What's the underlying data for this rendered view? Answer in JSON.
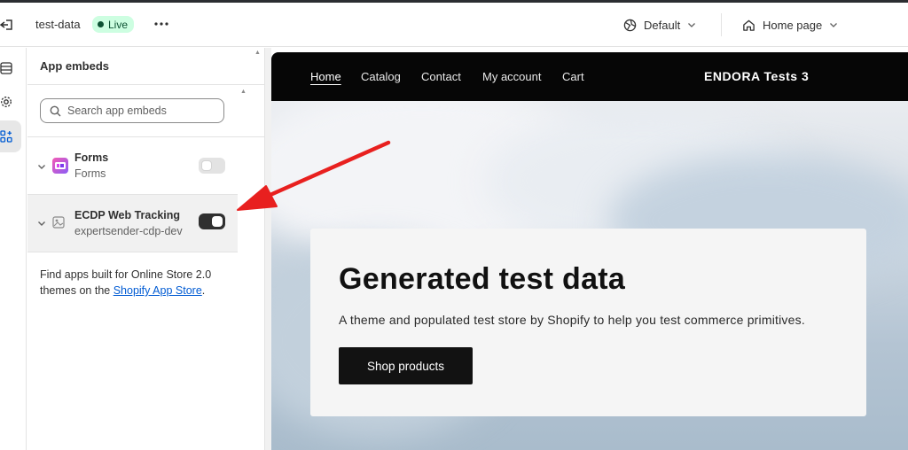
{
  "topbar": {
    "store_name": "test-data",
    "status_badge": "Live",
    "theme_select": "Default",
    "page_select": "Home page"
  },
  "panel": {
    "title": "App embeds",
    "search_placeholder": "Search app embeds",
    "embeds": [
      {
        "title": "Forms",
        "subtitle": "Forms",
        "enabled": false
      },
      {
        "title": "ECDP Web Tracking",
        "subtitle": "expertsender-cdp-dev",
        "enabled": true
      }
    ],
    "footer_text": "Find apps built for Online Store 2.0 themes on the ",
    "footer_link": "Shopify App Store",
    "footer_end": "."
  },
  "preview": {
    "nav": [
      "Home",
      "Catalog",
      "Contact",
      "My account",
      "Cart"
    ],
    "brand": "ENDORA Tests 3",
    "hero_title": "Generated test data",
    "hero_text": "A theme and populated test store by Shopify to help you test commerce primitives.",
    "hero_button": "Shop products"
  },
  "colors": {
    "live_badge_bg": "#cdfee1",
    "toggle_on": "#303030",
    "link": "#005bd3",
    "annotation_arrow": "#e8201f"
  }
}
